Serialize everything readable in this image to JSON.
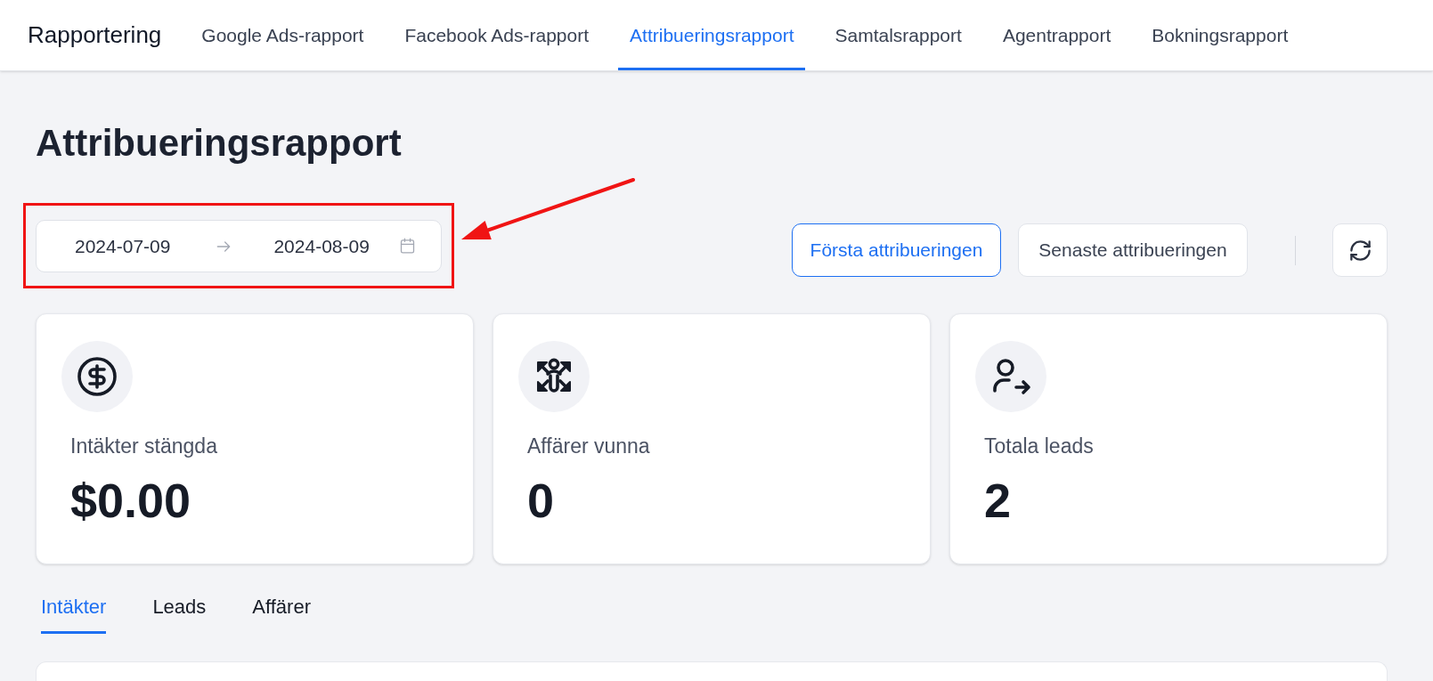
{
  "nav": {
    "brand": "Rapportering",
    "tabs": [
      {
        "label": "Google Ads-rapport",
        "selected": false
      },
      {
        "label": "Facebook Ads-rapport",
        "selected": false
      },
      {
        "label": "Attribueringsrapport",
        "selected": true
      },
      {
        "label": "Samtalsrapport",
        "selected": false
      },
      {
        "label": "Agentrapport",
        "selected": false
      },
      {
        "label": "Bokningsrapport",
        "selected": false
      }
    ]
  },
  "page_title": "Attribueringsrapport",
  "date_range": {
    "start": "2024-07-09",
    "end": "2024-08-09"
  },
  "attribution_modes": [
    {
      "label": "Första attribueringen",
      "selected": true
    },
    {
      "label": "Senaste attribueringen",
      "selected": false
    }
  ],
  "stats": [
    {
      "kind": "revenue",
      "label": "Intäkter stängda",
      "value": "$0.00"
    },
    {
      "kind": "deals",
      "label": "Affärer vunna",
      "value": "0"
    },
    {
      "kind": "leads",
      "label": "Totala leads",
      "value": "2"
    }
  ],
  "detail_tabs": [
    {
      "label": "Intäkter",
      "selected": true
    },
    {
      "label": "Leads",
      "selected": false
    },
    {
      "label": "Affärer",
      "selected": false
    }
  ],
  "annotations": [
    {
      "kind": "box-with-arrow"
    }
  ]
}
